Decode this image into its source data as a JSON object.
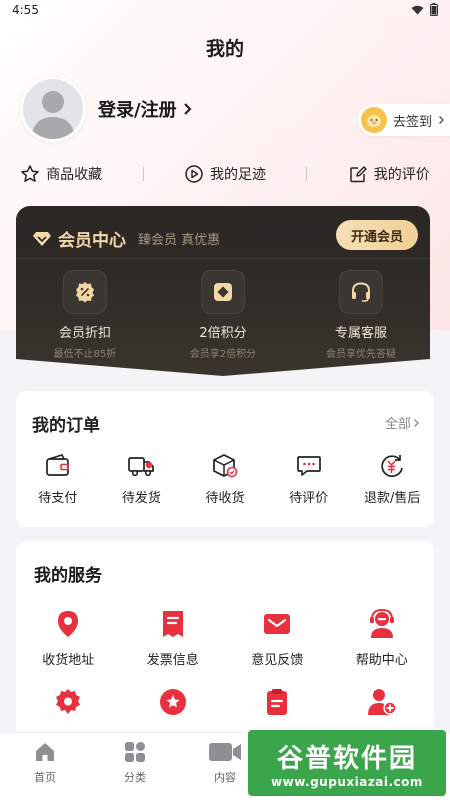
{
  "status_bar": {
    "time": "4:55"
  },
  "page": {
    "title": "我的"
  },
  "profile": {
    "login_label": "登录/注册",
    "signin_label": "去签到"
  },
  "quick_links": [
    {
      "label": "商品收藏",
      "icon": "star-icon"
    },
    {
      "label": "我的足迹",
      "icon": "footprint-icon"
    },
    {
      "label": "我的评价",
      "icon": "review-icon"
    }
  ],
  "vip": {
    "title": "会员中心",
    "slogan": "臻会员 真优惠",
    "button": "开通会员",
    "perks": [
      {
        "title": "会员折扣",
        "sub": "最低不止85折",
        "icon": "discount-icon"
      },
      {
        "title": "2倍积分",
        "sub": "会员享2倍积分",
        "icon": "points-icon"
      },
      {
        "title": "专属客服",
        "sub": "会员享优先答疑",
        "icon": "headset-icon"
      }
    ],
    "colors": {
      "gold": "#f3d7a6",
      "card": "#2b2724"
    }
  },
  "orders": {
    "title": "我的订单",
    "more": "全部",
    "items": [
      {
        "label": "待支付",
        "icon": "wallet-icon"
      },
      {
        "label": "待发货",
        "icon": "truck-icon"
      },
      {
        "label": "待收货",
        "icon": "package-icon"
      },
      {
        "label": "待评价",
        "icon": "comment-icon"
      },
      {
        "label": "退款/售后",
        "icon": "refund-icon"
      }
    ]
  },
  "services": {
    "title": "我的服务",
    "items": [
      {
        "label": "收货地址",
        "icon": "location-icon"
      },
      {
        "label": "发票信息",
        "icon": "invoice-icon"
      },
      {
        "label": "意见反馈",
        "icon": "mail-icon"
      },
      {
        "label": "帮助中心",
        "icon": "support-icon"
      }
    ],
    "row2_icons": [
      "settings-icon",
      "badge-icon",
      "clipboard-icon",
      "users-icon"
    ],
    "accent": "#e8303f"
  },
  "tabbar": [
    {
      "label": "首页",
      "icon": "home-icon"
    },
    {
      "label": "分类",
      "icon": "category-icon"
    },
    {
      "label": "内容",
      "icon": "video-icon"
    }
  ],
  "watermark": {
    "name": "谷普软件园",
    "url": "www.gupuxiazai.com"
  }
}
